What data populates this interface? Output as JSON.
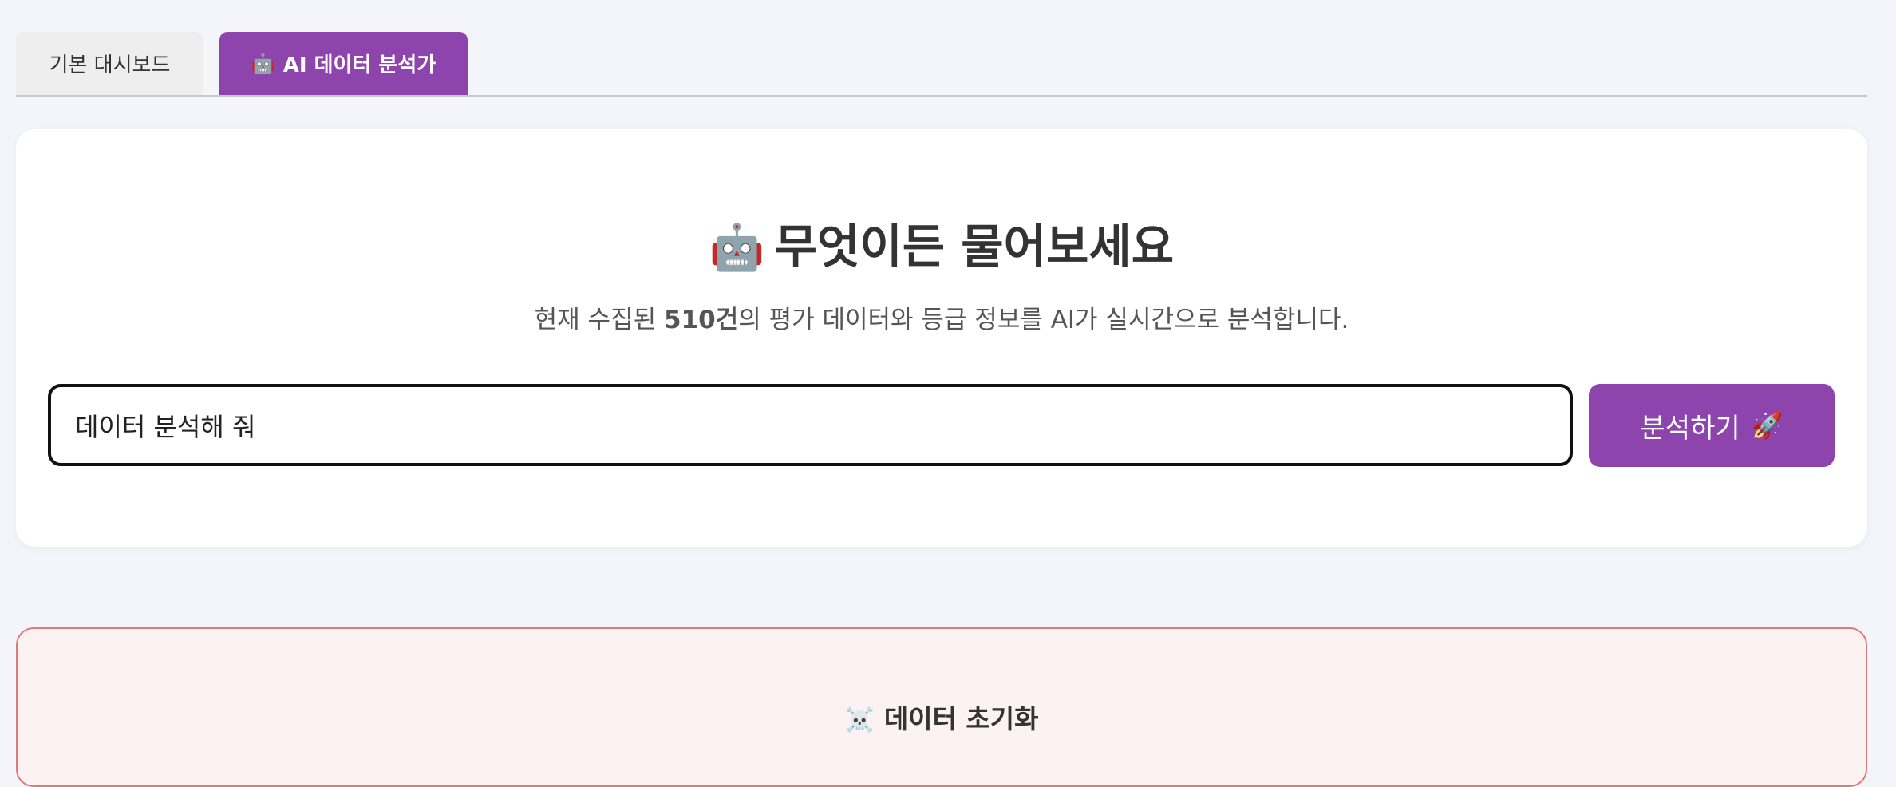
{
  "tabs": {
    "basic_label": "기본 대시보드",
    "ai_icon": "robot-icon",
    "ai_icon_glyph": "🤖",
    "ai_label": "AI 데이터 분석가"
  },
  "hero": {
    "icon": "robot-icon",
    "icon_glyph": "🤖",
    "title": "무엇이든 물어보세요",
    "subtitle_prefix": "현재 수집된 ",
    "subtitle_count": "510건",
    "subtitle_suffix": "의 평가 데이터와 등급 정보를 AI가 실시간으로 분석합니다."
  },
  "query": {
    "value": "데이터 분석해 줘"
  },
  "analyze_button": {
    "label": "분석하기",
    "icon": "rocket-icon",
    "icon_glyph": "🚀"
  },
  "reset": {
    "icon": "skull-crossbones-icon",
    "icon_glyph": "☠️",
    "title": "데이터 초기화"
  },
  "colors": {
    "accent": "#8e44ad",
    "danger_border": "#e07a7a",
    "danger_bg": "#fdf2f2",
    "page_bg": "#f4f5fa"
  }
}
